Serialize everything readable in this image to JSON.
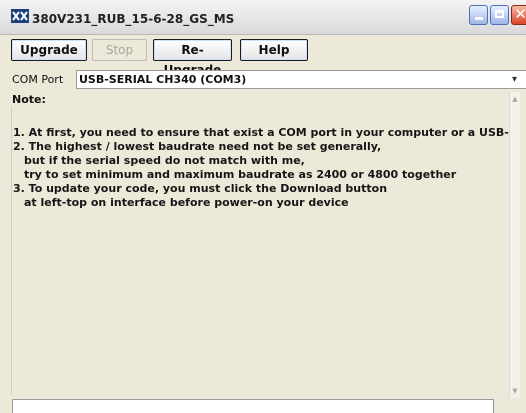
{
  "window": {
    "title": "380V231_RUB_15-6-28_GS_MS",
    "icon": "app-logo-icon"
  },
  "toolbar": {
    "upgrade_label": "Upgrade",
    "stop_label": "Stop",
    "reupgrade_label": "Re-Upgrade",
    "help_label": "Help"
  },
  "com": {
    "label": "COM Port",
    "value": "USB-SERIAL CH340 (COM3)"
  },
  "note": {
    "label": "Note:",
    "lines": [
      "1. At first, you need to ensure that exist a COM port      in your computer or a USB-",
      "2. The highest / lowest baudrate need not be set generally,",
      "but if the serial speed do not match with me,",
      "try to set minimum and maximum baudrate as 2400 or 4800 together",
      "3. To update your code, you must click the Download button",
      "at left-top on interface before power-on your device"
    ]
  },
  "colors": {
    "window_bg": "#ece9d8",
    "close_button": "#d8442a",
    "title_button_blue": "#9fb6e8"
  }
}
